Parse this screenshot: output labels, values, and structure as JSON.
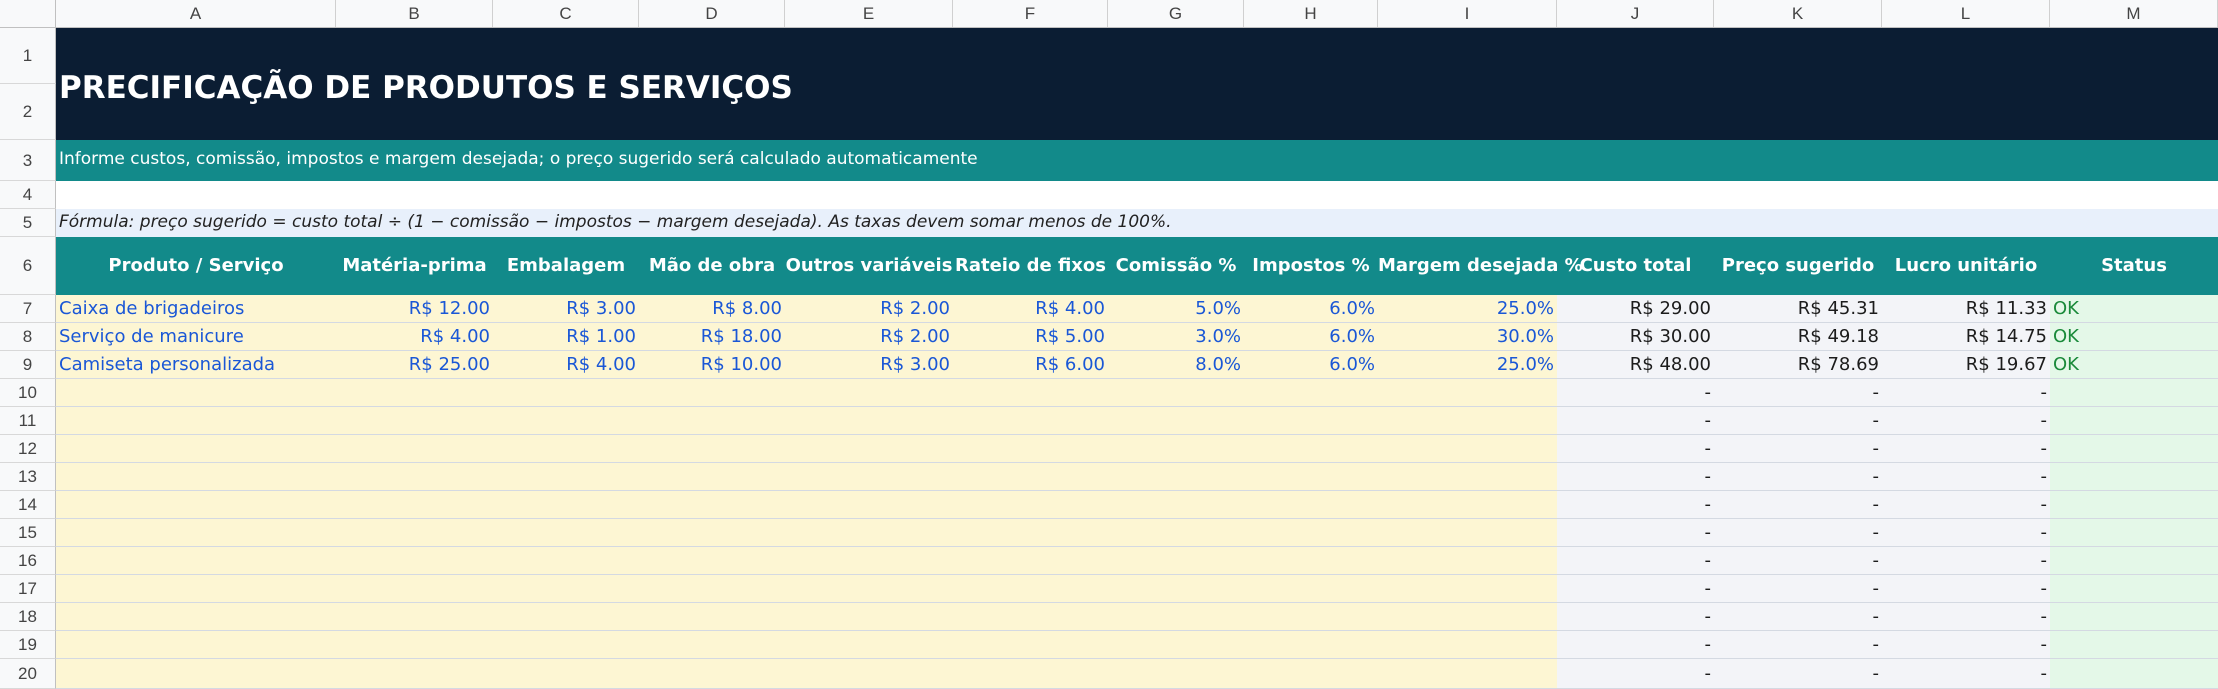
{
  "columns": [
    "A",
    "B",
    "C",
    "D",
    "E",
    "F",
    "G",
    "H",
    "I",
    "J",
    "K",
    "L",
    "M"
  ],
  "row_numbers": [
    "1",
    "2",
    "3",
    "4",
    "5",
    "6",
    "7",
    "8",
    "9",
    "10",
    "11",
    "12",
    "13",
    "14",
    "15",
    "16",
    "17",
    "18",
    "19",
    "20"
  ],
  "sheet": {
    "title": "PRECIFICAÇÃO DE PRODUTOS E SERVIÇOS",
    "subtitle": "Informe custos, comissão, impostos e margem desejada; o preço sugerido será calculado automaticamente",
    "formula": "Fórmula: preço sugerido = custo total ÷ (1 − comissão − impostos − margem desejada). As taxas devem somar menos de 100%.",
    "headers": [
      "Produto / Serviço",
      "Matéria-prima",
      "Embalagem",
      "Mão de obra",
      "Outros variáveis",
      "Rateio de fixos",
      "Comissão %",
      "Impostos %",
      "Margem desejada %",
      "Custo total",
      "Preço sugerido",
      "Lucro unitário",
      "Status"
    ],
    "rows": [
      [
        "Caixa de brigadeiros",
        "R$ 12.00",
        "R$ 3.00",
        "R$ 8.00",
        "R$ 2.00",
        "R$ 4.00",
        "5.0%",
        "6.0%",
        "25.0%",
        "R$ 29.00",
        "R$ 45.31",
        "R$ 11.33",
        "OK"
      ],
      [
        "Serviço de manicure",
        "R$ 4.00",
        "R$ 1.00",
        "R$ 18.00",
        "R$ 2.00",
        "R$ 5.00",
        "3.0%",
        "6.0%",
        "30.0%",
        "R$ 30.00",
        "R$ 49.18",
        "R$ 14.75",
        "OK"
      ],
      [
        "Camiseta personalizada",
        "R$ 25.00",
        "R$ 4.00",
        "R$ 10.00",
        "R$ 3.00",
        "R$ 6.00",
        "8.0%",
        "6.0%",
        "25.0%",
        "R$ 48.00",
        "R$ 78.69",
        "R$ 19.67",
        "OK"
      ],
      [
        "",
        "",
        "",
        "",
        "",
        "",
        "",
        "",
        "",
        "-",
        "-",
        "-",
        ""
      ],
      [
        "",
        "",
        "",
        "",
        "",
        "",
        "",
        "",
        "",
        "-",
        "-",
        "-",
        ""
      ],
      [
        "",
        "",
        "",
        "",
        "",
        "",
        "",
        "",
        "",
        "-",
        "-",
        "-",
        ""
      ],
      [
        "",
        "",
        "",
        "",
        "",
        "",
        "",
        "",
        "",
        "-",
        "-",
        "-",
        ""
      ],
      [
        "",
        "",
        "",
        "",
        "",
        "",
        "",
        "",
        "",
        "-",
        "-",
        "-",
        ""
      ],
      [
        "",
        "",
        "",
        "",
        "",
        "",
        "",
        "",
        "",
        "-",
        "-",
        "-",
        ""
      ],
      [
        "",
        "",
        "",
        "",
        "",
        "",
        "",
        "",
        "",
        "-",
        "-",
        "-",
        ""
      ],
      [
        "",
        "",
        "",
        "",
        "",
        "",
        "",
        "",
        "",
        "-",
        "-",
        "-",
        ""
      ],
      [
        "",
        "",
        "",
        "",
        "",
        "",
        "",
        "",
        "",
        "-",
        "-",
        "-",
        ""
      ],
      [
        "",
        "",
        "",
        "",
        "",
        "",
        "",
        "",
        "",
        "-",
        "-",
        "-",
        ""
      ],
      [
        "",
        "",
        "",
        "",
        "",
        "",
        "",
        "",
        "",
        "-",
        "-",
        "-",
        ""
      ]
    ]
  },
  "colors": {
    "title_bg": "#0b1d33",
    "accent": "#128a8a",
    "input_bg": "#fdf6d3",
    "input_text": "#1a57d6",
    "status_ok": "#1a8a3a"
  }
}
